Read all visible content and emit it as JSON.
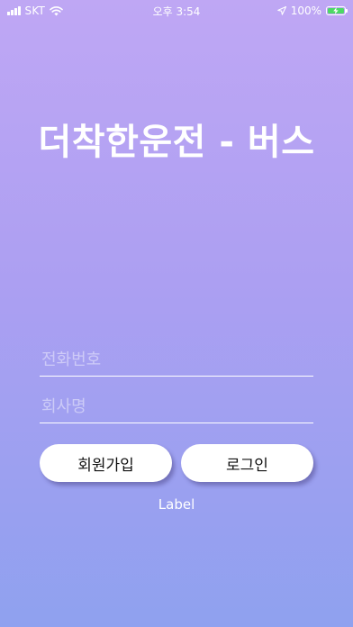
{
  "status_bar": {
    "carrier": "SKT",
    "time": "오후 3:54",
    "battery_percent": "100%",
    "battery_level": 1.0,
    "icons": [
      "signal-icon",
      "wifi-icon",
      "location-arrow-icon",
      "battery-charging-icon"
    ]
  },
  "title": "더착한운전 - 버스",
  "form": {
    "phone_placeholder": "전화번호",
    "phone_value": "",
    "company_placeholder": "회사명",
    "company_value": ""
  },
  "buttons": {
    "signup_label": "회원가입",
    "login_label": "로그인"
  },
  "footer_label": "Label",
  "colors": {
    "gradient_top": "#bfa7f4",
    "gradient_bottom": "#8fa1ef",
    "button_bg": "#ffffff",
    "battery_fill": "#4cd964"
  }
}
